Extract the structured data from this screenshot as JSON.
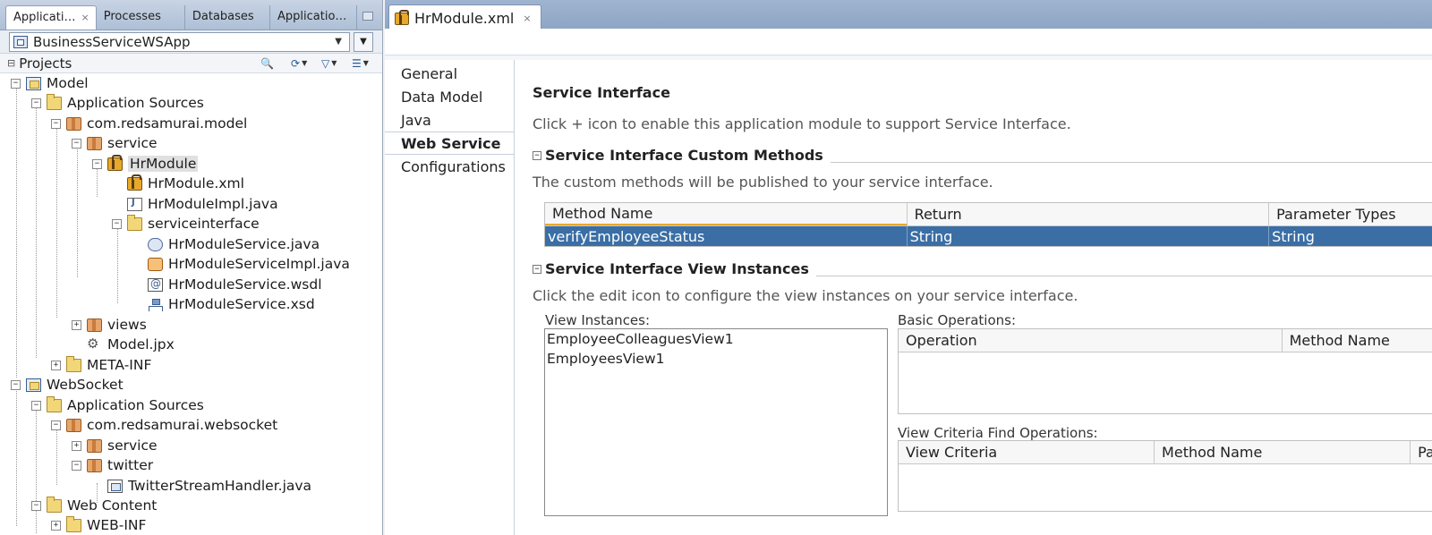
{
  "left_tabs": [
    {
      "label": "Applicati…",
      "active": true,
      "close": "×"
    },
    {
      "label": "Processes"
    },
    {
      "label": "Databases"
    },
    {
      "label": "Applicatio…"
    }
  ],
  "app_selector": {
    "value": "BusinessServiceWSApp"
  },
  "projects": {
    "title": "Projects"
  },
  "tree": [
    {
      "label": "Model",
      "icon": "project-icon"
    },
    {
      "label": "Application Sources",
      "icon": "folder-icon"
    },
    {
      "label": "com.redsamurai.model",
      "icon": "package-icon"
    },
    {
      "label": "service",
      "icon": "package-icon"
    },
    {
      "label": "HrModule",
      "icon": "app-module-icon"
    },
    {
      "label": "HrModule.xml",
      "icon": "app-module-icon"
    },
    {
      "label": "HrModuleImpl.java",
      "icon": "java-file-icon"
    },
    {
      "label": "serviceinterface",
      "icon": "folder-icon"
    },
    {
      "label": "HrModuleService.java",
      "icon": "java-service-icon"
    },
    {
      "label": "HrModuleServiceImpl.java",
      "icon": "java-impl-icon"
    },
    {
      "label": "HrModuleService.wsdl",
      "icon": "wsdl-icon"
    },
    {
      "label": "HrModuleService.xsd",
      "icon": "xsd-icon"
    },
    {
      "label": "views",
      "icon": "package-icon"
    },
    {
      "label": "Model.jpx",
      "icon": "jpx-icon"
    },
    {
      "label": "META-INF",
      "icon": "folder-icon"
    },
    {
      "label": "WebSocket",
      "icon": "project-icon"
    },
    {
      "label": "Application Sources",
      "icon": "folder-icon"
    },
    {
      "label": "com.redsamurai.websocket",
      "icon": "package-icon"
    },
    {
      "label": "service",
      "icon": "package-icon"
    },
    {
      "label": "twitter",
      "icon": "package-icon"
    },
    {
      "label": "TwitterStreamHandler.java",
      "icon": "java-file-icon"
    },
    {
      "label": "Web Content",
      "icon": "folder-icon"
    },
    {
      "label": "WEB-INF",
      "icon": "folder-icon"
    }
  ],
  "editor_tab": {
    "label": "HrModule.xml",
    "close": "×"
  },
  "nav": [
    "General",
    "Data Model",
    "Java",
    "Web Service",
    "Configurations"
  ],
  "nav_active": "Web Service",
  "content": {
    "title": "Service Interface",
    "intro": "Click + icon to enable this application module to support Service Interface.",
    "custom_methods": {
      "title": "Service Interface Custom Methods",
      "desc": "The custom methods will be published to your service interface.",
      "columns": [
        "Method Name",
        "Return",
        "Parameter Types"
      ],
      "rows": [
        [
          "verifyEmployeeStatus",
          "String",
          "String"
        ]
      ]
    },
    "view_instances": {
      "title": "Service Interface View Instances",
      "desc": "Click the edit icon to configure the view instances on your service interface.",
      "list_label": "View Instances:",
      "list": [
        "EmployeeColleaguesView1",
        "EmployeesView1"
      ],
      "basic_ops_label": "Basic Operations:",
      "basic_ops_columns": [
        "Operation",
        "Method Name"
      ],
      "vc_ops_label": "View Criteria Find Operations:",
      "vc_ops_columns": [
        "View Criteria",
        "Method Name",
        "Pa"
      ]
    }
  },
  "colors": {
    "selection": "#3a6ea5",
    "tab_strip": "#8ea5c5"
  }
}
